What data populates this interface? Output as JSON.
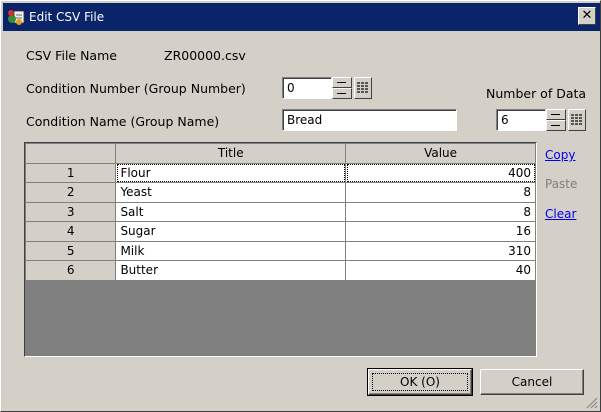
{
  "window": {
    "title": "Edit CSV File",
    "close_symbol": "✕"
  },
  "csv_file": {
    "label": "CSV File Name",
    "value": "ZR00000.csv"
  },
  "condition_number": {
    "label": "Condition Number (Group Number)",
    "value": "0"
  },
  "condition_name": {
    "label": "Condition Name (Group Name)",
    "value": "Bread"
  },
  "number_of_data": {
    "label": "Number of Data",
    "value": "6"
  },
  "grid": {
    "columns": [
      "Title",
      "Value"
    ],
    "rows": [
      {
        "num": "1",
        "title": "Flour",
        "value": "400"
      },
      {
        "num": "2",
        "title": "Yeast",
        "value": "8"
      },
      {
        "num": "3",
        "title": "Salt",
        "value": "8"
      },
      {
        "num": "4",
        "title": "Sugar",
        "value": "16"
      },
      {
        "num": "5",
        "title": "Milk",
        "value": "310"
      },
      {
        "num": "6",
        "title": "Butter",
        "value": "40"
      }
    ]
  },
  "side_actions": {
    "copy": "Copy",
    "paste": "Paste",
    "clear": "Clear"
  },
  "buttons": {
    "ok": "OK (O)",
    "cancel": "Cancel"
  }
}
